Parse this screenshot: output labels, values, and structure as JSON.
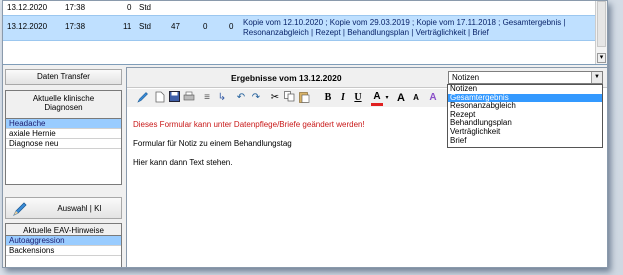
{
  "top_table": {
    "rows": [
      {
        "date": "13.12.2020",
        "time": "17:38",
        "count": "0",
        "unit": "Std",
        "a": "",
        "b": "",
        "c": "",
        "desc": ""
      },
      {
        "date": "13.12.2020",
        "time": "17:38",
        "count": "11",
        "unit": "Std",
        "a": "47",
        "b": "0",
        "c": "0",
        "desc": "Kopie vom 12.10.2020 ; Kopie vom 29.03.2019 ; Kopie vom 17.11.2018 ; Gesamtergebnis | Resonanzabgleich | Rezept | Behandlungsplan | Verträglichkeit | Brief"
      }
    ]
  },
  "left": {
    "transfer_button": "Daten Transfer",
    "diagnoses_header_line1": "Aktuelle klinische",
    "diagnoses_header_line2": "Diagnosen",
    "diagnoses": [
      "Headache",
      "axiale Hernie",
      "Diagnose neu"
    ],
    "auswahl_button": "Auswahl | KI",
    "eav_header": "Aktuelle EAV-Hinweise",
    "eav_items": [
      "Autoaggression",
      "Backensions"
    ]
  },
  "right": {
    "title": "Ergebnisse vom 13.12.2020",
    "combo_value": "Notizen",
    "dropdown": [
      "Notizen",
      "Gesamtergebnis",
      "Resonanzabgleich",
      "Rezept",
      "Behandlungsplan",
      "Verträglichkeit",
      "Brief"
    ],
    "dropdown_selected_index": 1,
    "editor": {
      "warning": "Dieses Formular kann unter Datenpflege/Briefe geändert werden!",
      "line1": "Formular für Notiz zu einem Behandlungstag",
      "line2": "Hier kann dann Text stehen."
    },
    "toolbar": {
      "bold": "B",
      "italic": "I",
      "underline": "U",
      "font_color": "A",
      "grow": "A",
      "shrink": "A",
      "clear": "A"
    }
  },
  "colors": {
    "selection": "#99ccff",
    "dropdown_selection": "#3399ff",
    "warning": "#c81818"
  }
}
